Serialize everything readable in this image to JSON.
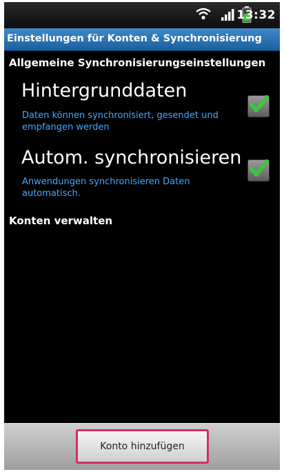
{
  "status_bar": {
    "time": "13:32",
    "icons": [
      "wifi-icon",
      "signal-icon",
      "battery-icon"
    ],
    "battery_color": "#3ec43e"
  },
  "title_bar": {
    "title": "Einstellungen für Konten & Synchronisierung",
    "background": "#2b73b5"
  },
  "sections": {
    "general_header": "Allgemeine Synchronisierungseinstellungen",
    "accounts_header": "Konten verwalten"
  },
  "preferences": [
    {
      "title": "Hintergrunddaten",
      "summary": "Daten können synchronisiert, gesendet und empfangen werden",
      "checked": true
    },
    {
      "title": "Autom. synchronisieren",
      "summary": "Anwendungen synchronisieren Daten automatisch.",
      "checked": true
    }
  ],
  "bottom_bar": {
    "add_account_label": "Konto hinzufügen",
    "highlight_color": "#d02d6a"
  },
  "colors": {
    "summary_text": "#44a8ff",
    "checkmark": "#3ec43e"
  }
}
